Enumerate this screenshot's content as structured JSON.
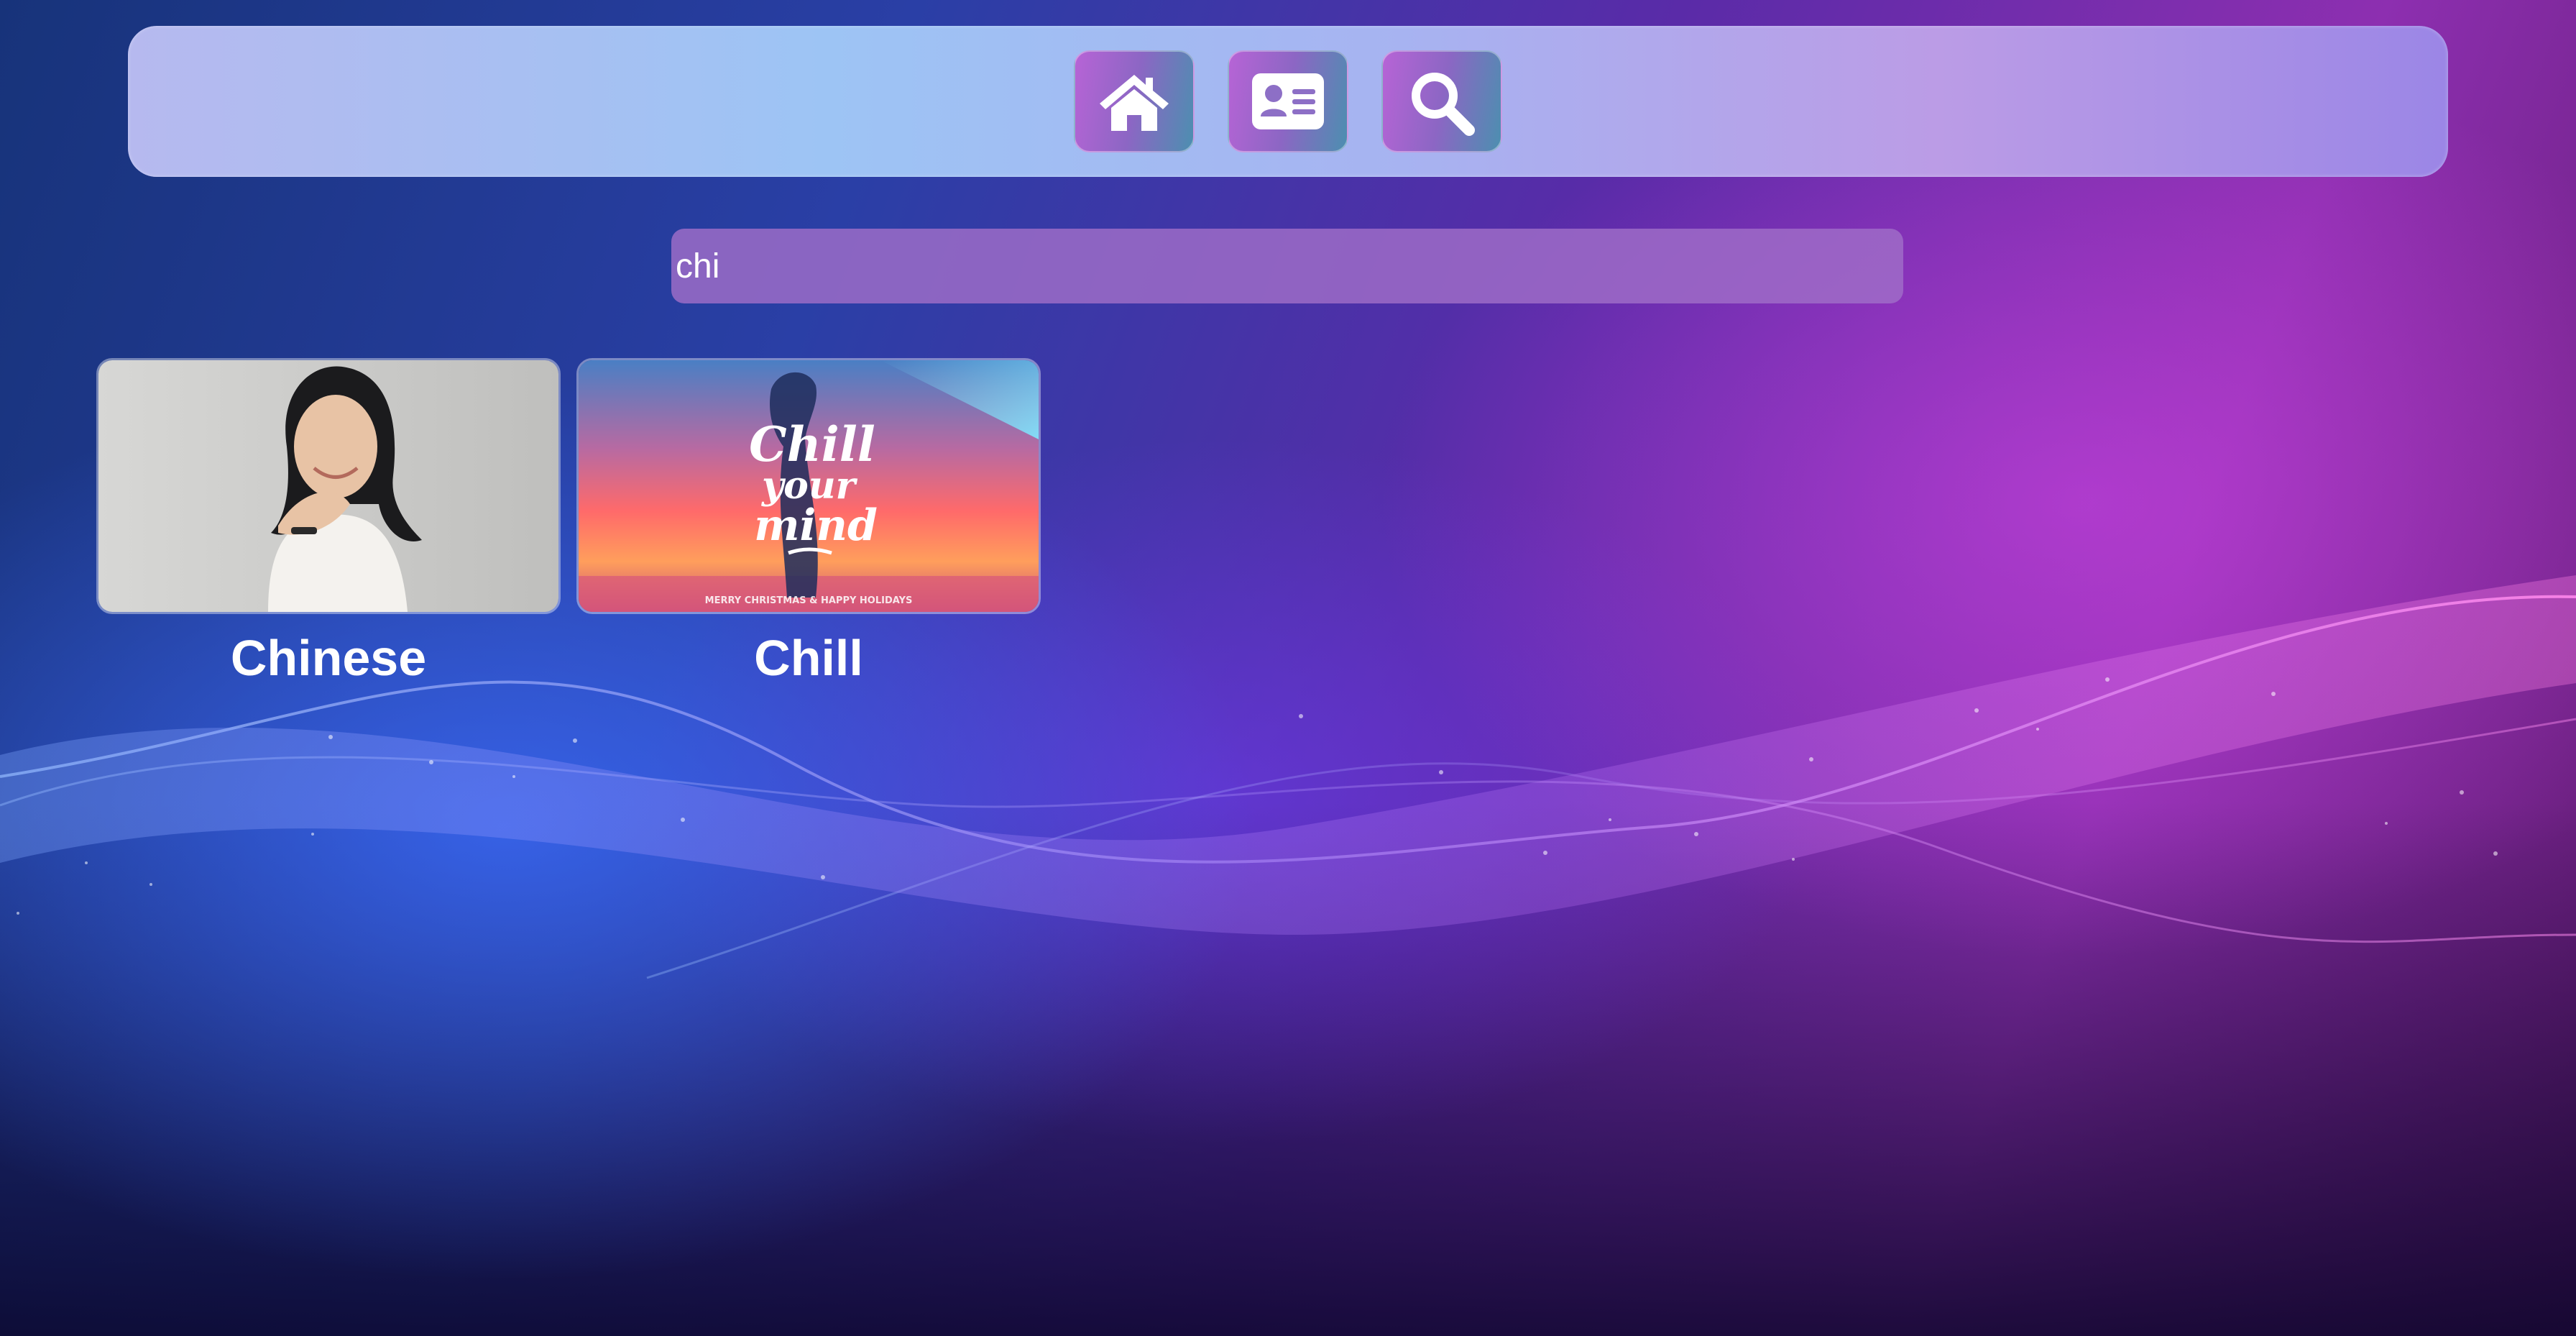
{
  "nav": {
    "buttons": [
      {
        "id": "home",
        "icon": "home-icon"
      },
      {
        "id": "profile",
        "icon": "id-card-icon"
      },
      {
        "id": "search",
        "icon": "search-icon"
      }
    ]
  },
  "search": {
    "value": "chi",
    "placeholder": ""
  },
  "results": [
    {
      "label": "Chinese",
      "thumbnail": "portrait-photo"
    },
    {
      "label": "Chill",
      "thumbnail": "chill-your-mind-artwork",
      "artwork_text": [
        "Chill",
        "your",
        "mind",
        "MERRY CHRISTMAS & HAPPY HOLIDAYS"
      ]
    }
  ],
  "colors": {
    "accent": "#b764d6",
    "search_field": "#9b69c4",
    "text": "#ffffff"
  }
}
